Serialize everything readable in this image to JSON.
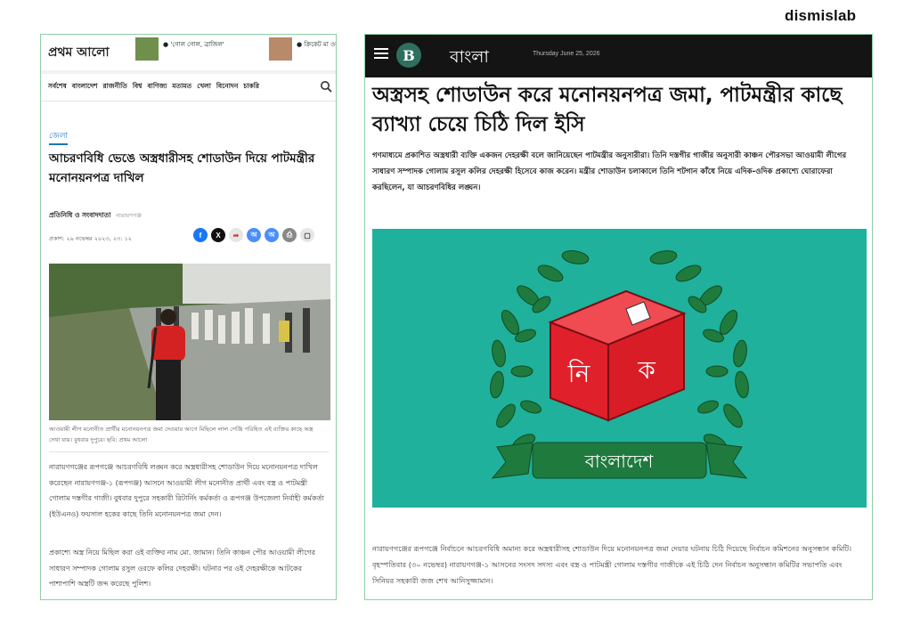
{
  "brand": "dismislab",
  "left": {
    "logo": "প্রথম আলো",
    "top_news": [
      "● 'গোল গোল, ব্রাজিল'",
      "● ক্রিকেট মা ওয়ার্ডে, শীতল"
    ],
    "nav_items": [
      "সর্বশেষ",
      "বাংলাদেশ",
      "রাজনীতি",
      "বিশ্ব",
      "বাণিজ্য",
      "মতামত",
      "খেলা",
      "বিনোদন",
      "চাকরি"
    ],
    "section_tag": "জেলা",
    "headline": "আচরণবিধি ভেঙে অস্ত্রধারীসহ শোডাউন দিয়ে পাটমন্ত্রীর মনোনয়নপত্র দাখিল",
    "author": "প্রতিনিধি ও সংবাদদাতা",
    "author_location": "নারায়ণগঞ্জ",
    "published": "প্রকাশ: ২৯ নভেম্বর ২০২৩, ২৩: ১২",
    "caption": "আওয়ামী লীগ মনোনীত প্রার্থীর মনোনয়নপত্র জমা দেওয়ার আগে মিছিলে লাল গেঞ্জি পরিহিত এই ব্যক্তির কাছে অস্ত্র দেখা যায়। বুধবার দুপুরে। ছবি: প্রথম আলো",
    "body1": "নারায়ণগঞ্জের রূপগঞ্জে আচরণবিধি লঙ্ঘন করে অস্ত্রধারীসহ শোডাউন দিয়ে মনোনয়নপত্র দাখিল করেছেন নারায়ণগঞ্জ-১ (রূপগঞ্জ) আসনে আওয়ামী লীগ মনোনীত প্রার্থী এবং বস্ত্র ও পাটমন্ত্রী গোলাম দস্তগীর গাজী। বুধবার দুপুরে সহকারী রিটার্নিং কর্মকর্তা ও রূপগঞ্জ উপজেলা নির্বাহী কর্মকর্তা (ইউএনও) ফয়সাল হকের কাছে তিনি মনোনয়নপত্র জমা দেন।",
    "body2": "প্রকাশ্যে অস্ত্র নিয়ে মিছিল করা ওই ব্যক্তির নাম মো. জামান। তিনি কাঞ্চন পৌর আওয়ামী লীগের সাধারণ সম্পাদক গোলাম রসুল ওরফে কলির দেহরক্ষী। ঘটনার পর ওই দেহরক্ষীকে আটকের পাশাপাশি অস্ত্রটি জব্দ করেছে পুলিশ।"
  },
  "right": {
    "site_name": "বাংলা",
    "date": "Thursday June 25, 2026",
    "headline": "অস্ত্রসহ শোডাউন করে মনোনয়নপত্র জমা, পাটমন্ত্রীর কাছে ব্যাখ্যা চেয়ে চিঠি দিল ইসি",
    "lead": "গণমাধ্যমে প্রকাশিত অস্ত্রধারী ব্যক্তি একজন দেহরক্ষী বলে জানিয়েছেন পাটমন্ত্রীর অনুসারীরা। তিনি দস্তগীর গাজীর অনুসারী কাঞ্চন পৌরসভা আওয়ামী লীগের সাধারণ সম্পাদক গোলাম রসুল কলির দেহরক্ষী হিসেবে কাজ করেন। মন্ত্রীর শোডাউন চলাকালে তিনি শটগান কাঁধে নিয়ে এদিক-ওদিক প্রকাশ্যে ঘোরাফেরা করছিলেন, যা আচরণবিধির লঙ্ঘন।",
    "emblem_box_left": "নি",
    "emblem_box_right": "ক",
    "emblem_ribbon": "বাংলাদেশ",
    "body": "নারায়ণগঞ্জের রূপগঞ্জে নির্বাচনে আচরণবিধি অমান্য করে অস্ত্রধারীসহ শোডাউন দিয়ে মনোনয়নপত্র জমা দেয়ার ঘটনায় চিঠি দিয়েছে নির্বাচন কমিশনের অনুসন্ধান কমিটি। বৃহস্পতিবার (৩০ নভেম্বর) নারায়ণগঞ্জ-১ আসনের সংসদ সদস্য এবং বস্ত্র ও পাটমন্ত্রী গোলাম দস্তগীর গাজীকে এই চিঠি দেন নির্বাচন অনুসন্ধান কমিটির সভাপতি এবং সিনিয়র সহকারী জজ শেখ আনিসুজ্জামান।"
  },
  "colors": {
    "accent_green": "#8fcfa5",
    "emblem_teal": "#1fb19c",
    "emblem_red": "#e0202b",
    "link_blue": "#1a73c7"
  }
}
